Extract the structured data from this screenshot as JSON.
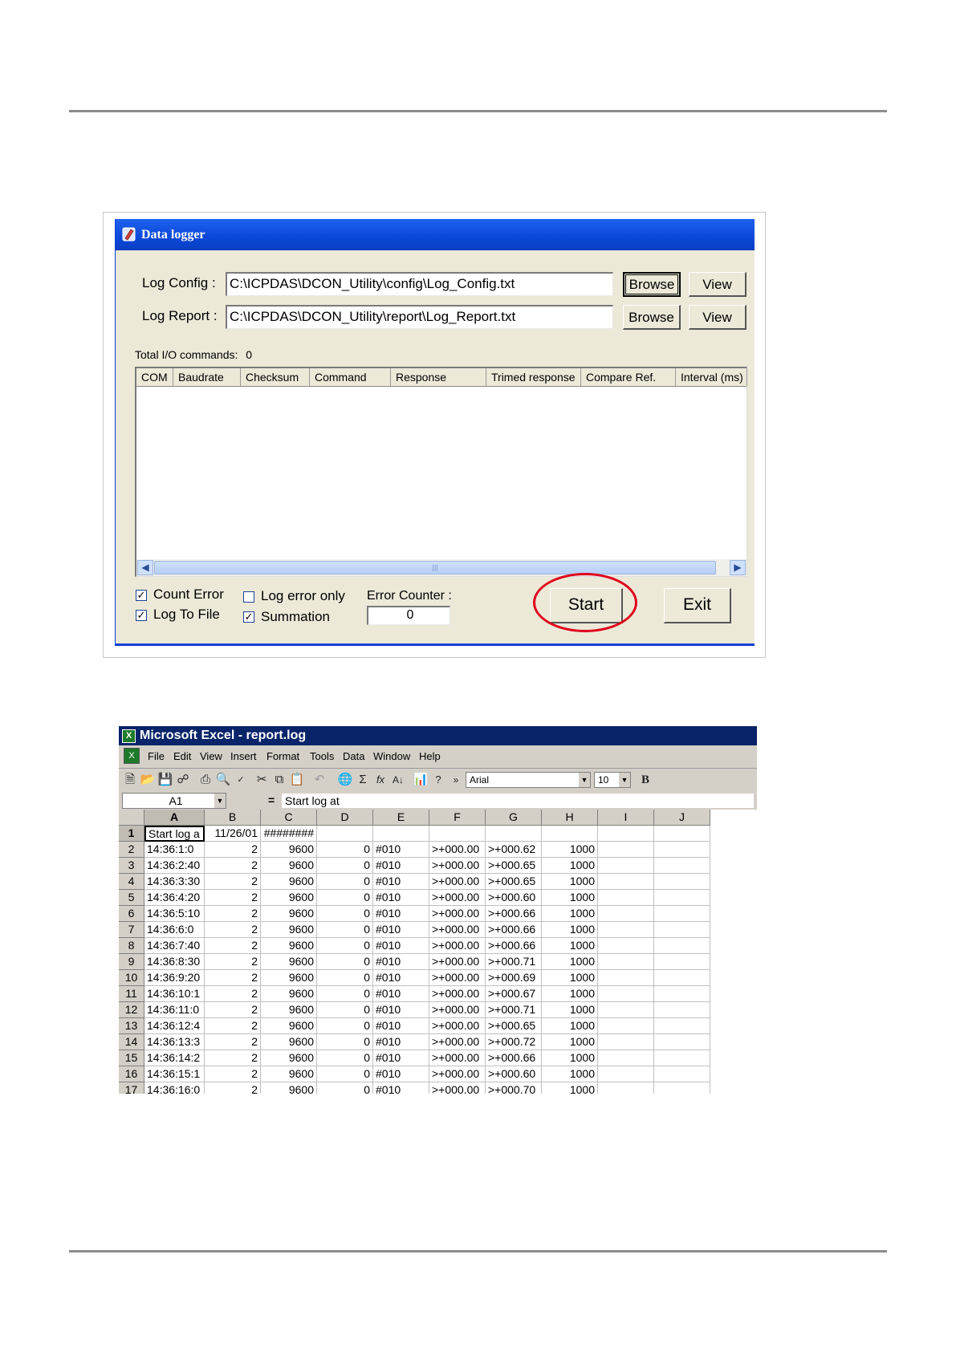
{
  "data_logger": {
    "title": "Data logger",
    "log_config_label": "Log Config :",
    "log_config_value": "C:\\ICPDAS\\DCON_Utility\\config\\Log_Config.txt",
    "log_report_label": "Log Report :",
    "log_report_value": "C:\\ICPDAS\\DCON_Utility\\report\\Log_Report.txt",
    "browse_label": "Browse",
    "view_label": "View",
    "total_label": "Total I/O commands:",
    "total_value": "0",
    "columns": [
      "COM",
      "Baudrate",
      "Checksum",
      "Command",
      "Response",
      "Trimed response",
      "Compare Ref.",
      "Interval (ms)"
    ],
    "count_error": {
      "label": "Count Error",
      "checked": true
    },
    "log_to_file": {
      "label": "Log To File",
      "checked": true
    },
    "log_error_only": {
      "label": "Log error only",
      "checked": false
    },
    "summation": {
      "label": "Summation",
      "checked": true
    },
    "error_counter_label": "Error Counter :",
    "error_counter_value": "0",
    "start_label": "Start",
    "exit_label": "Exit",
    "highlight_color": "#e0001a"
  },
  "excel": {
    "title": "Microsoft Excel - report.log",
    "menu": [
      "File",
      "Edit",
      "View",
      "Insert",
      "Format",
      "Tools",
      "Data",
      "Window",
      "Help"
    ],
    "font_name": "Arial",
    "font_size": "10",
    "bold_label": "B",
    "name_box": "A1",
    "formula_eq": "=",
    "formula_value": "Start log at",
    "col_headers": [
      "A",
      "B",
      "C",
      "D",
      "E",
      "F",
      "G",
      "H",
      "I",
      "J"
    ],
    "rows": [
      [
        "Start log a",
        "11/26/01",
        "########",
        "",
        "",
        "",
        "",
        "",
        "",
        ""
      ],
      [
        "14:36:1:0",
        "2",
        "9600",
        "0",
        "#010",
        ">+000.00",
        ">+000.62",
        "1000",
        "",
        ""
      ],
      [
        "14:36:2:40",
        "2",
        "9600",
        "0",
        "#010",
        ">+000.00",
        ">+000.65",
        "1000",
        "",
        ""
      ],
      [
        "14:36:3:30",
        "2",
        "9600",
        "0",
        "#010",
        ">+000.00",
        ">+000.65",
        "1000",
        "",
        ""
      ],
      [
        "14:36:4:20",
        "2",
        "9600",
        "0",
        "#010",
        ">+000.00",
        ">+000.60",
        "1000",
        "",
        ""
      ],
      [
        "14:36:5:10",
        "2",
        "9600",
        "0",
        "#010",
        ">+000.00",
        ">+000.66",
        "1000",
        "",
        ""
      ],
      [
        "14:36:6:0",
        "2",
        "9600",
        "0",
        "#010",
        ">+000.00",
        ">+000.66",
        "1000",
        "",
        ""
      ],
      [
        "14:36:7:40",
        "2",
        "9600",
        "0",
        "#010",
        ">+000.00",
        ">+000.66",
        "1000",
        "",
        ""
      ],
      [
        "14:36:8:30",
        "2",
        "9600",
        "0",
        "#010",
        ">+000.00",
        ">+000.71",
        "1000",
        "",
        ""
      ],
      [
        "14:36:9:20",
        "2",
        "9600",
        "0",
        "#010",
        ">+000.00",
        ">+000.69",
        "1000",
        "",
        ""
      ],
      [
        "14:36:10:1",
        "2",
        "9600",
        "0",
        "#010",
        ">+000.00",
        ">+000.67",
        "1000",
        "",
        ""
      ],
      [
        "14:36:11:0",
        "2",
        "9600",
        "0",
        "#010",
        ">+000.00",
        ">+000.71",
        "1000",
        "",
        ""
      ],
      [
        "14:36:12:4",
        "2",
        "9600",
        "0",
        "#010",
        ">+000.00",
        ">+000.65",
        "1000",
        "",
        ""
      ],
      [
        "14:36:13:3",
        "2",
        "9600",
        "0",
        "#010",
        ">+000.00",
        ">+000.72",
        "1000",
        "",
        ""
      ],
      [
        "14:36:14:2",
        "2",
        "9600",
        "0",
        "#010",
        ">+000.00",
        ">+000.66",
        "1000",
        "",
        ""
      ],
      [
        "14:36:15:1",
        "2",
        "9600",
        "0",
        "#010",
        ">+000.00",
        ">+000.60",
        "1000",
        "",
        ""
      ],
      [
        "14:36:16:0",
        "2",
        "9600",
        "0",
        "#010",
        ">+000.00",
        ">+000.70",
        "1000",
        "",
        ""
      ]
    ],
    "right_align_cols": [
      1,
      2,
      3,
      7
    ]
  }
}
